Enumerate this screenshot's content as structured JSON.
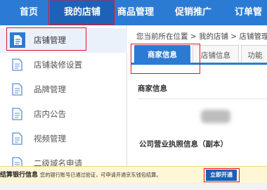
{
  "top_nav": {
    "items": [
      "首页",
      "我的店铺",
      "商品管理",
      "促销推广",
      "订单管"
    ],
    "active_index": 1
  },
  "sidebar": {
    "items": [
      "店铺管理",
      "店铺装修设置",
      "品牌管理",
      "店内公告",
      "视频管理",
      "二级域名申请"
    ],
    "active_index": 0,
    "icons": [
      "document-icon",
      "document-icon",
      "document-icon",
      "document-icon",
      "document-icon",
      "document-icon"
    ]
  },
  "breadcrumb": {
    "text": "您当前所在位置 > 我的店铺 > 店铺管理"
  },
  "tabs": {
    "items": [
      "商家信息",
      "店铺信息",
      "功能"
    ],
    "active_index": 0
  },
  "content": {
    "merchant_info_title": "商家信息",
    "license_title": "公司营业执照信息（副本）"
  },
  "banner": {
    "title": "结算银行信息",
    "message": "您的银行账号已通过验证，可申请开通京东钱包结算。",
    "button_label": "立即开通"
  },
  "colors": {
    "nav_blue": "#2b7bd4",
    "nav_active": "#1c63b8",
    "highlight_red": "#e0162b",
    "banner_bg": "#fff6d6",
    "button_blue": "#1d5fb5"
  }
}
